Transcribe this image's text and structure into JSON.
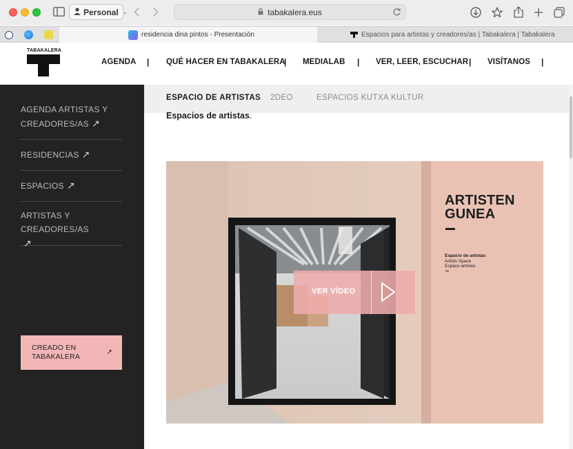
{
  "browser": {
    "profile_label": "Personal",
    "url": "tabakalera.eus",
    "tabs": [
      {
        "title": "residencia dina pintos - Presentación",
        "active": true
      },
      {
        "title": "Espacios para artistas y creadores/as | Tabakalera | Tabakalera",
        "active": false
      }
    ],
    "colors": {
      "close": "#fe5f57",
      "minimize": "#febc2e",
      "zoom": "#28c840"
    }
  },
  "site": {
    "logo_text": "TABAKALERA",
    "nav": [
      "AGENDA",
      "QUÉ HACER EN TABAKALERA",
      "MEDIALAB",
      "VER, LEER, ESCUCHAR",
      "VISÍTANOS"
    ],
    "separator": "|"
  },
  "sidebar": {
    "items": [
      {
        "line1": "AGENDA ARTISTAS Y",
        "line2": "CREADORES/AS"
      },
      {
        "line1": "RESIDENCIAS",
        "line2": ""
      },
      {
        "line1": "ESPACIOS",
        "line2": ""
      },
      {
        "line1": "ARTISTAS Y CREADORES/AS",
        "line2": ""
      }
    ],
    "arrow_glyph": "↗",
    "cta": {
      "line1": "CREADO EN",
      "line2": "TABAKALERA",
      "arrow": "↗"
    }
  },
  "subnav": {
    "tabs": [
      {
        "label": "ESPACIO DE ARTISTAS",
        "active": true
      },
      {
        "label": "2DEO",
        "active": false
      },
      {
        "label": "ESPACIOS KUTXA KULTUR",
        "active": false
      }
    ]
  },
  "content": {
    "intro_bold": "Espacios de artistas",
    "intro_suffix": ".",
    "video": {
      "button_label": "VER VÍDEO",
      "sign_line1": "ARTISTEN",
      "sign_line2": "GUNEA",
      "sign_sub1": "Espacio de artistas",
      "sign_sub2": "Artists Space",
      "sign_sub3": "Espace artistes"
    }
  },
  "colors": {
    "sidebar_bg": "#232323",
    "cta_bg": "#f2b6b6",
    "play_overlay": "#eeacac"
  }
}
